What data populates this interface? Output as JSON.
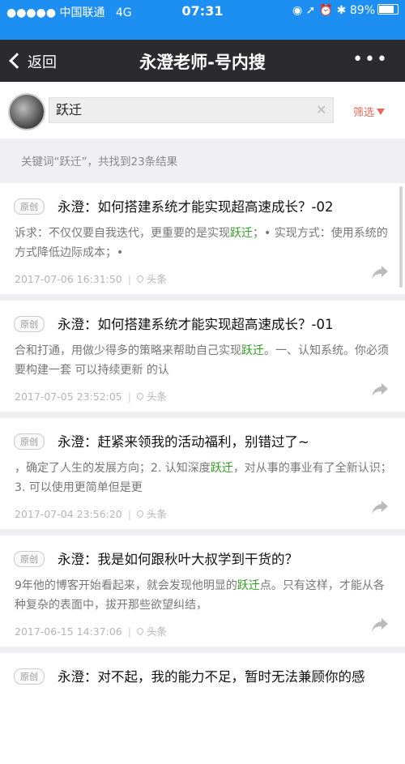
{
  "status_bar": {
    "carrier": "●●●●● 中国联通",
    "network": "4G",
    "time": "07:31",
    "icons": "◉ ➚ ⏰ ✱",
    "battery": "89%",
    "battery_level": 0.89
  },
  "nav": {
    "back_label": "返回",
    "title": "永澄老师-号内搜",
    "more_label": "•••"
  },
  "search": {
    "query": "跃迁",
    "filter_label": "筛选"
  },
  "summary": "关键词“跃迁”，共找到23条结果",
  "results": [
    {
      "badge": "原创",
      "title": "永澄：如何搭建系统才能实现超高速成长？-02",
      "snippet_before": "诉求：不仅仅要自我迭代，更重要的是实现",
      "keyword": "跃迁",
      "snippet_after": "；• 实现方式：使用系统的方式降低边际成本；•",
      "date": "2017-07-06 16:31:50",
      "source": "头条"
    },
    {
      "badge": "原创",
      "title": "永澄：如何搭建系统才能实现超高速成长？-01",
      "snippet_before": "合和打通，用做少得多的策略来帮助自己实现",
      "keyword": "跃迁",
      "snippet_after": "。一、认知系统。你必须要构建一套 可以持续更新 的认",
      "date": "2017-07-05 23:52:05",
      "source": "头条"
    },
    {
      "badge": "原创",
      "title": "永澄：赶紧来领我的活动福利，别错过了~",
      "snippet_before": "，确定了人生的发展方向；2. 认知深度",
      "keyword": "跃迁",
      "snippet_after": "，对从事的事业有了全新认识；3. 可以使用更简单但是更",
      "date": "2017-07-04 23:56:20",
      "source": "头条"
    },
    {
      "badge": "原创",
      "title": "永澄：我是如何跟秋叶大叔学到干货的？",
      "snippet_before": "9年他的博客开始看起来，就会发现他明显的",
      "keyword": "跃迁",
      "snippet_after": "点。只有这样，才能从各种复杂的表面中，拔开那些欲望纠结，",
      "date": "2017-06-15 14:37:06",
      "source": "头条"
    },
    {
      "badge": "原创",
      "title": "永澄：对不起，我的能力不足，暂时无法兼顾你的感"
    }
  ]
}
